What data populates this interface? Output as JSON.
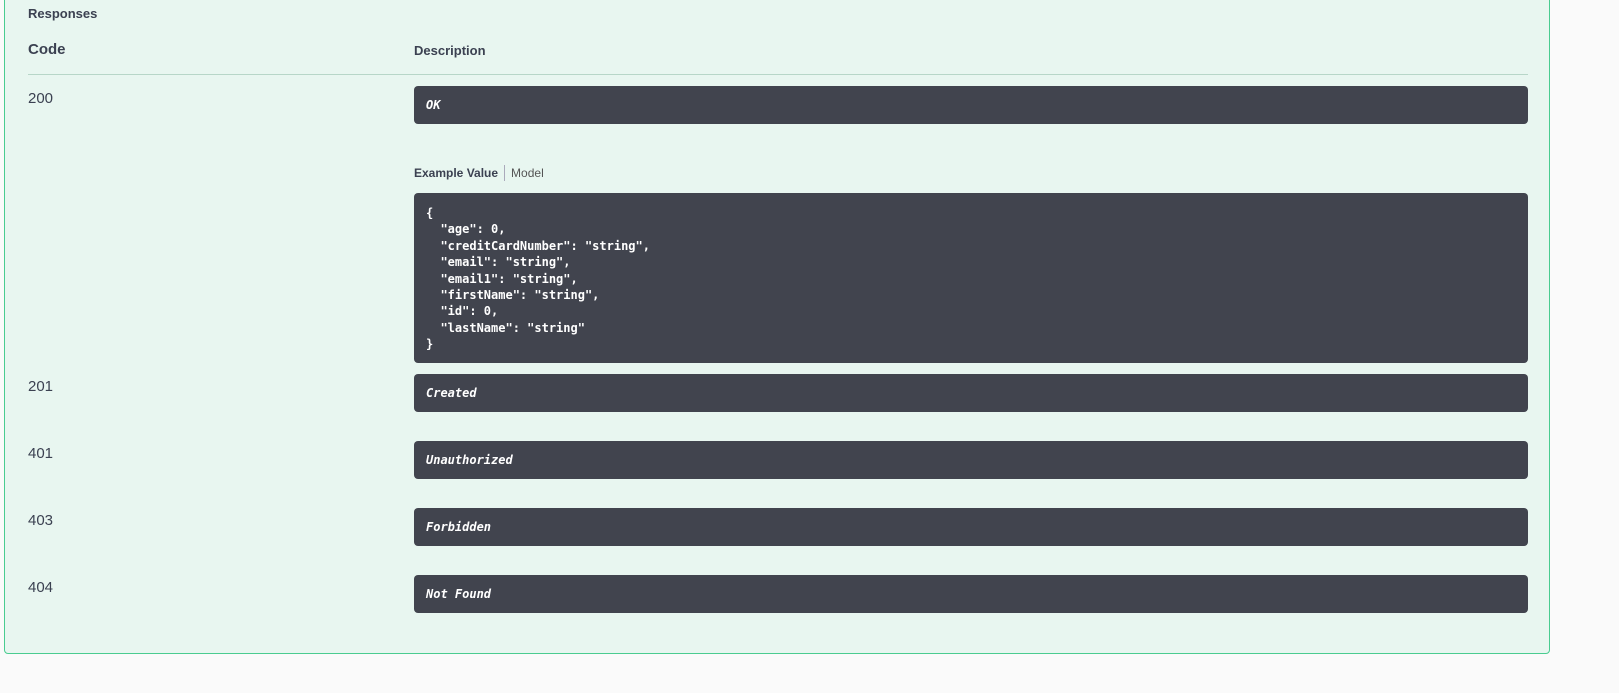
{
  "responses": {
    "title": "Responses",
    "columns": {
      "code": "Code",
      "description": "Description"
    },
    "rows": [
      {
        "code": "200",
        "description": "OK"
      },
      {
        "code": "201",
        "description": "Created"
      },
      {
        "code": "401",
        "description": "Unauthorized"
      },
      {
        "code": "403",
        "description": "Forbidden"
      },
      {
        "code": "404",
        "description": "Not Found"
      }
    ],
    "example": {
      "tab_example": "Example Value",
      "tab_model": "Model",
      "code": "{\n  \"age\": 0,\n  \"creditCardNumber\": \"string\",\n  \"email\": \"string\",\n  \"email1\": \"string\",\n  \"firstName\": \"string\",\n  \"id\": 0,\n  \"lastName\": \"string\"\n}"
    }
  },
  "colors": {
    "panel_background": "#e8f6f0",
    "panel_border": "#49cc90",
    "box_background": "#41444e"
  }
}
